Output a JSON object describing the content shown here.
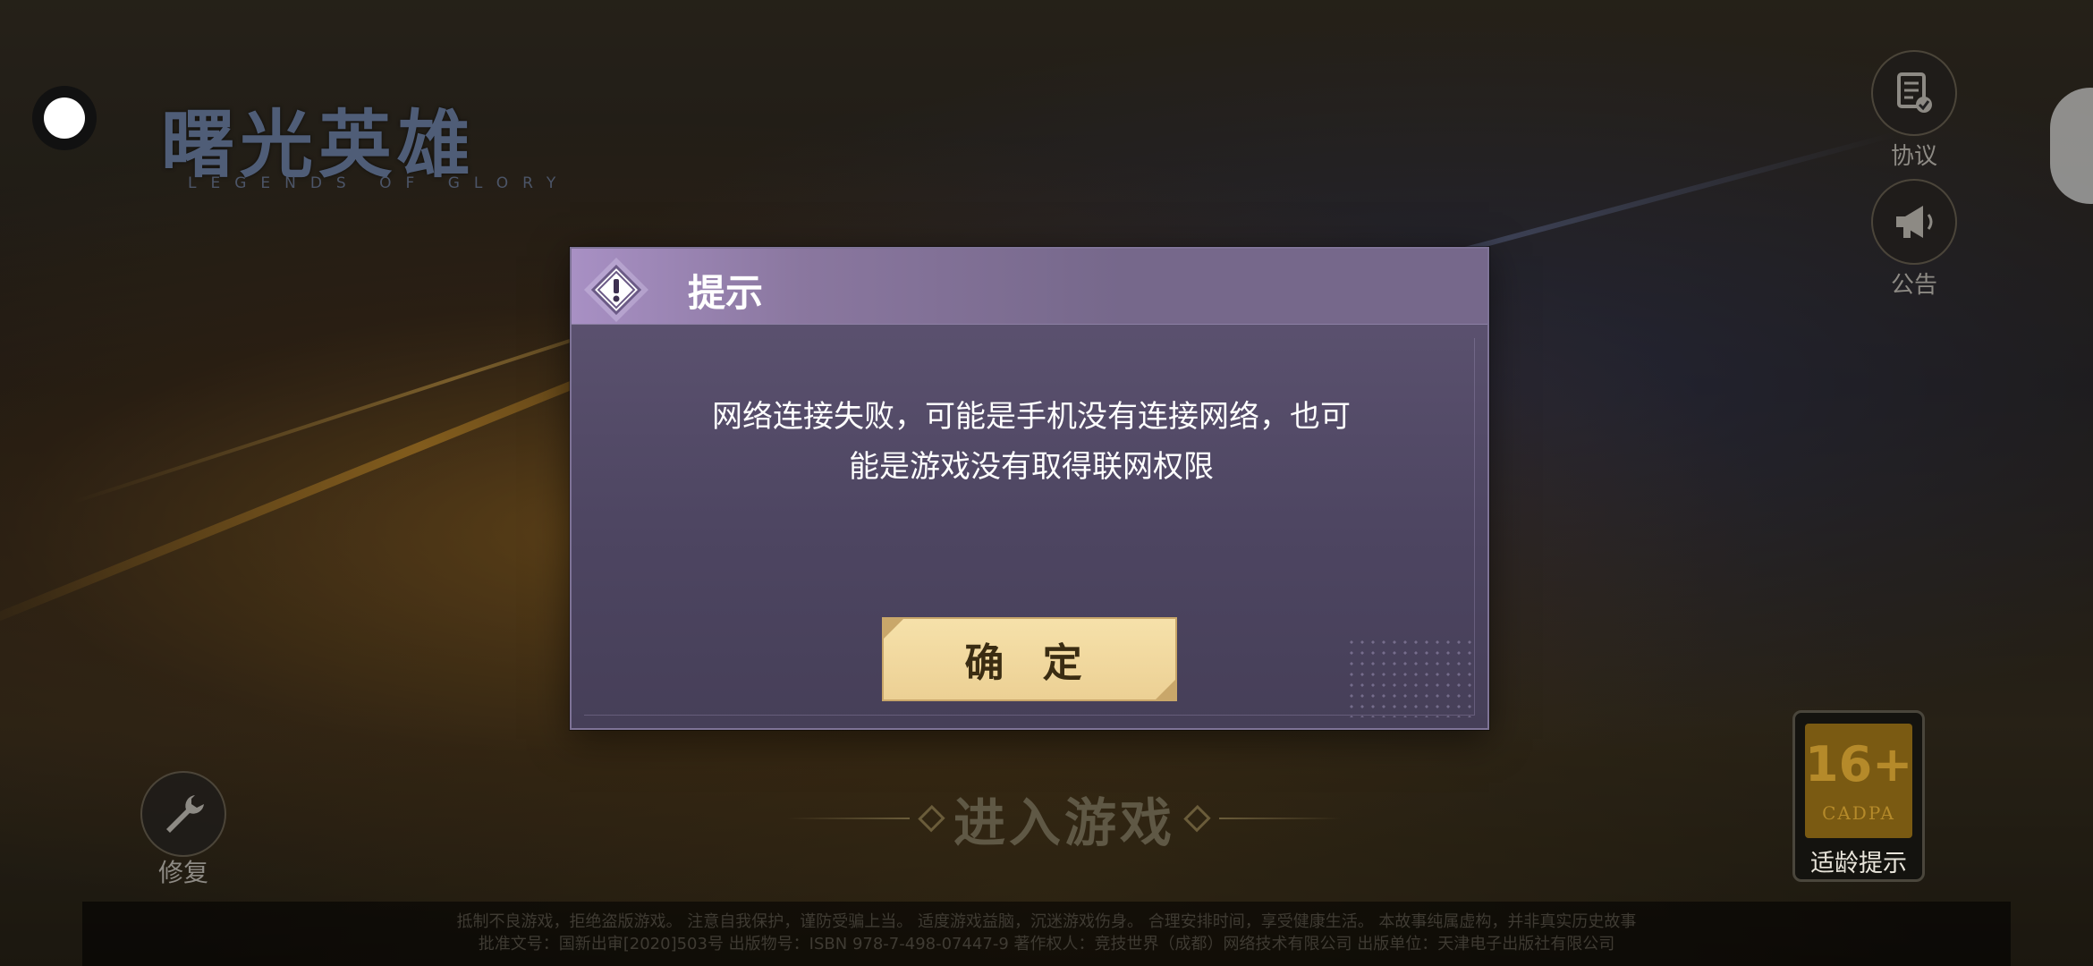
{
  "logo": {
    "title": "曙光英雄",
    "subtitle": "LEGENDS OF GLORY"
  },
  "side_buttons": {
    "agreement_label": "协议",
    "notice_label": "公告"
  },
  "repair": {
    "label": "修复"
  },
  "enter_game": {
    "label": "进入游戏"
  },
  "age_rating": {
    "number": "16+",
    "org": "CADPA",
    "label": "适龄提示"
  },
  "footer": {
    "line1": "抵制不良游戏，拒绝盗版游戏。 注意自我保护，谨防受骗上当。 适度游戏益脑，沉迷游戏伤身。 合理安排时间，享受健康生活。 本故事纯属虚构，并非真实历史故事",
    "line2": "批准文号：国新出审[2020]503号 出版物号：ISBN 978-7-498-07447-9 著作权人：竞技世界（成都）网络技术有限公司 出版单位：天津电子出版社有限公司"
  },
  "dialog": {
    "title": "提示",
    "message_line1": "网络连接失败，可能是手机没有连接网络，也可",
    "message_line2": "能是游戏没有取得联网权限",
    "confirm_label": "确 定"
  },
  "colors": {
    "dialog_bg": "#4d4561",
    "dialog_header": "#76688b",
    "confirm_bg": "#f6e1aa",
    "age_badge": "#7a5a12"
  }
}
